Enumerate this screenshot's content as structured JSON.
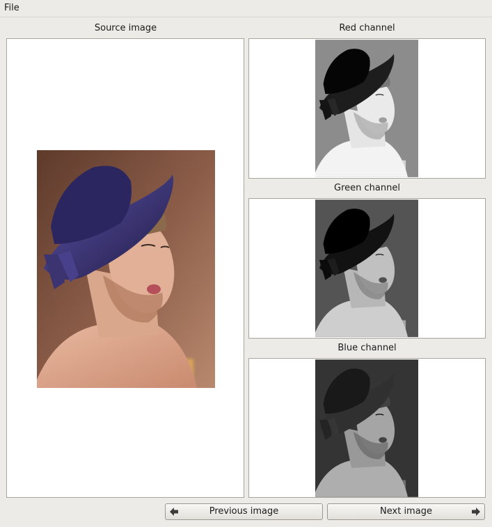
{
  "menu": {
    "file_label": "File"
  },
  "panels": {
    "source_label": "Source image",
    "red_label": "Red channel",
    "green_label": "Green channel",
    "blue_label": "Blue channel"
  },
  "buttons": {
    "previous_label": "Previous image",
    "next_label": "Next image"
  },
  "icons": {
    "previous": "arrow-left-icon",
    "next": "arrow-right-icon"
  },
  "colors": {
    "window_bg": "#edebe7",
    "frame_border": "#a9a49c",
    "hat": "#3b3470",
    "background_brown": "#7a4f3c"
  }
}
